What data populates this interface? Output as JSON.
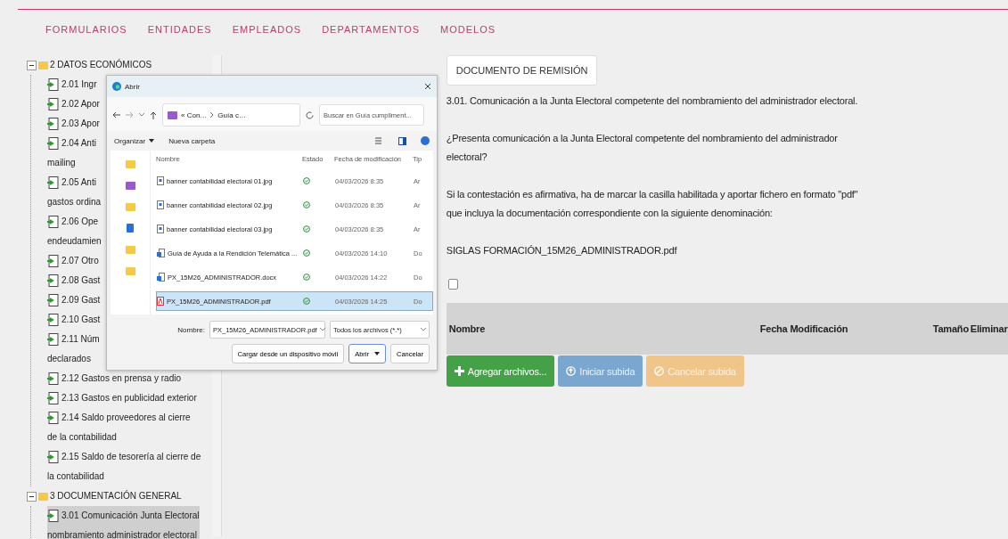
{
  "nav": [
    "FORMULARIOS",
    "ENTIDADES",
    "EMPLEADOS",
    "DEPARTAMENTOS",
    "MODELOS"
  ],
  "tree": [
    {
      "label": "2 DATOS ECONÓMICOS",
      "expanded": true,
      "children": [
        {
          "lines": [
            "2.01 Ingr"
          ],
          "selected": false
        },
        {
          "lines": [
            "2.02 Apor"
          ],
          "selected": false
        },
        {
          "lines": [
            "2.03 Apor"
          ],
          "selected": false
        },
        {
          "lines": [
            "2.04 Anti",
            "mailing"
          ],
          "selected": false
        },
        {
          "lines": [
            "2.05 Anti",
            "gastos ordina"
          ],
          "selected": false
        },
        {
          "lines": [
            "2.06 Ope",
            "endeudamien"
          ],
          "selected": false
        },
        {
          "lines": [
            "2.07 Otro"
          ],
          "selected": false
        },
        {
          "lines": [
            "2.08 Gast"
          ],
          "selected": false
        },
        {
          "lines": [
            "2.09 Gast"
          ],
          "selected": false
        },
        {
          "lines": [
            "2.10 Gast"
          ],
          "selected": false
        },
        {
          "lines": [
            "2.11 Núm",
            "declarados"
          ],
          "selected": false
        },
        {
          "lines": [
            "2.12 Gastos en prensa y radio"
          ],
          "selected": false
        },
        {
          "lines": [
            "2.13 Gastos en publicidad exterior"
          ],
          "selected": false
        },
        {
          "lines": [
            "2.14 Saldo proveedores al cierre",
            "de la contabilidad"
          ],
          "selected": false
        },
        {
          "lines": [
            "2.15 Saldo de tesorería al cierre de",
            "la contabilidad"
          ],
          "selected": false
        }
      ]
    },
    {
      "label": "3 DOCUMENTACIÓN GENERAL",
      "expanded": true,
      "children": [
        {
          "lines": [
            "3.01 Comunicación Junta Electoral",
            "nombramiento administrador electoral"
          ],
          "selected": true
        }
      ]
    }
  ],
  "content": {
    "document_button": "DOCUMENTO DE REMISIÓN",
    "paragraphs": [
      [
        "3.01. Comunicación a la Junta Electoral competente del nombramiento del administrador electoral."
      ],
      [
        "¿Presenta comunicación a la Junta Electoral competente del nombramiento del administrador",
        "electoral?"
      ],
      [
        "Si la contestación es afirmativa, ha de marcar la casilla habilitada y aportar fichero en formato \"pdf\"",
        "que incluya la documentación correspondiente con la siguiente denominación:"
      ],
      [
        "SIGLAS FORMACIÓN_15M26_ADMINISTRADOR.pdf"
      ]
    ],
    "checkbox": {
      "checked": false
    },
    "table": {
      "columns": [
        "Nombre",
        "Fecha Modificación",
        "Tamaño",
        "Eliminar"
      ]
    },
    "buttons": [
      {
        "label": "Agregar archivos...",
        "kind": "add"
      },
      {
        "label": "Iniciar subida",
        "kind": "upload"
      },
      {
        "label": "Cancelar subida",
        "kind": "cancel"
      }
    ]
  },
  "dialog": {
    "title": "Abrir",
    "path": [
      "« Con…",
      "Guía c…"
    ],
    "search_placeholder": "Buscar en Guía cumpliment...",
    "toolbar": [
      "Organizar",
      "Nueva carpeta"
    ],
    "columns": [
      "Nombre",
      "Estado",
      "Fecha de modificación",
      "Tip"
    ],
    "files": [
      {
        "name": "banner contabilidad electoral 01.jpg",
        "kind": "image",
        "date": "04/03/2026 8:35",
        "type": "Ar",
        "selected": false
      },
      {
        "name": "banner contabilidad electoral 02.jpg",
        "kind": "image",
        "date": "04/03/2026 8:35",
        "type": "Ar",
        "selected": false
      },
      {
        "name": "banner contabilidad electoral 03.jpg",
        "kind": "image",
        "date": "04/03/2026 8:35",
        "type": "Ar",
        "selected": false
      },
      {
        "name": "Guía de Ayuda a la Rendición Telemática ...",
        "kind": "word",
        "date": "04/03/2026 14:10",
        "type": "Do",
        "selected": false
      },
      {
        "name": "PX_15M26_ADMINISTRADOR.docx",
        "kind": "word",
        "date": "04/03/2026 14:22",
        "type": "Do",
        "selected": false
      },
      {
        "name": "PX_15M26_ADMINISTRADOR.pdf",
        "kind": "pdf",
        "date": "04/03/2026 14:25",
        "type": "Do",
        "selected": true
      }
    ],
    "file_name_label": "Nombre:",
    "file_name": "PX_15M26_ADMINISTRADOR.pdf",
    "filter": "Todos los archivos (*.*)",
    "buttons": [
      {
        "label": "Cargar desde un dispositivo móvil",
        "kind": "plain"
      },
      {
        "label": "Abrir",
        "kind": "primary"
      },
      {
        "label": "Cancelar",
        "kind": "plain"
      }
    ]
  }
}
